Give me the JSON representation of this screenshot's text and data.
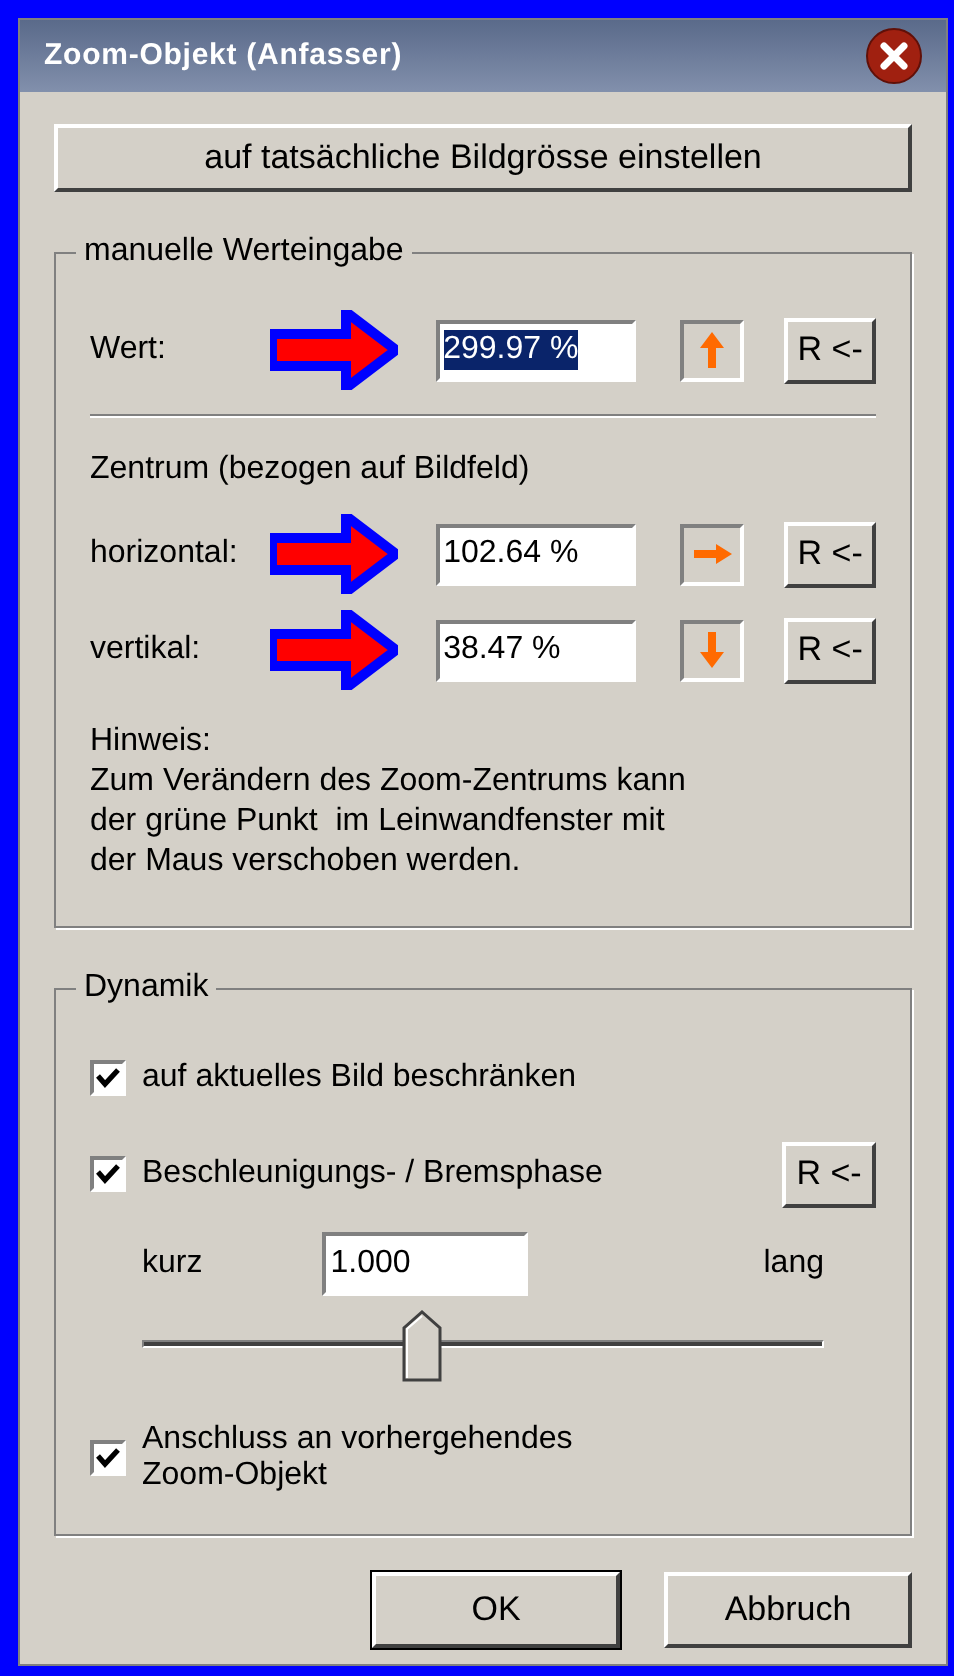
{
  "window": {
    "title": "Zoom-Objekt (Anfasser)"
  },
  "size_button": "auf tatsächliche Bildgrösse einstellen",
  "manual": {
    "legend": "manuelle Werteingabe",
    "value_rows": [
      {
        "label": "Wert:",
        "value": "299.97 %",
        "selected": true,
        "kind": "up",
        "reset": "R <-"
      }
    ],
    "center_heading": "Zentrum (bezogen auf Bildfeld)",
    "center_rows": [
      {
        "label": "horizontal:",
        "value": "102.64 %",
        "selected": false,
        "kind": "right",
        "reset": "R <-"
      },
      {
        "label": "vertikal:",
        "value": "38.47 %",
        "selected": false,
        "kind": "down",
        "reset": "R <-"
      }
    ],
    "note": "Hinweis:\nZum Verändern des Zoom-Zentrums kann\nder grüne Punkt  im Leinwandfenster mit\nder Maus verschoben werden."
  },
  "dynamics": {
    "legend": "Dynamik",
    "items": [
      {
        "kind": "checkbox",
        "label": "auf aktuelles Bild beschränken",
        "checked": true
      },
      {
        "kind": "checkbox",
        "label": "Beschleunigungs- / Bremsphase",
        "checked": true,
        "reset": "R <-"
      },
      {
        "kind": "slider",
        "min_label": "kurz",
        "value": "1.000",
        "max_label": "lang",
        "level": 0.41
      },
      {
        "kind": "checkbox",
        "label": "Anschluss an vorhergehendes\nZoom-Objekt",
        "checked": true
      }
    ]
  },
  "buttons": [
    {
      "label": "OK",
      "default": true
    },
    {
      "label": "Abbruch",
      "default": false
    }
  ]
}
